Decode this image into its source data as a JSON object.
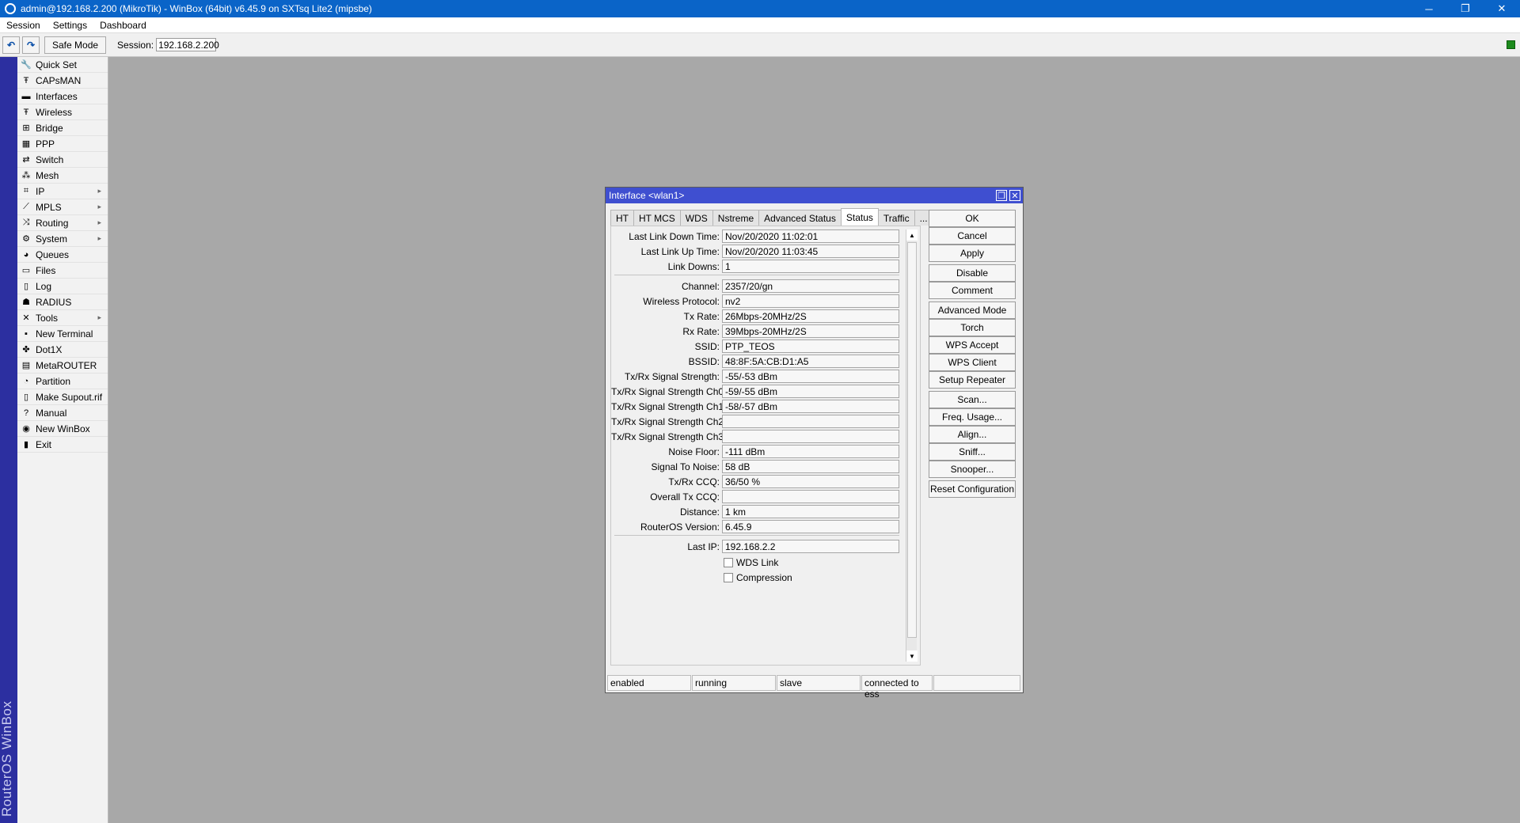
{
  "titlebar": {
    "title": "admin@192.168.2.200 (MikroTik) - WinBox (64bit) v6.45.9 on SXTsq Lite2 (mipsbe)",
    "minimize": "─",
    "restore": "❐",
    "close": "✕"
  },
  "menubar": {
    "items": [
      "Session",
      "Settings",
      "Dashboard"
    ]
  },
  "toolbar": {
    "undo": "↶",
    "redo": "↷",
    "safe_mode": "Safe Mode",
    "session_label": "Session:",
    "session_value": "192.168.2.200"
  },
  "side_strip": {
    "text": "RouterOS WinBox"
  },
  "sidebar": {
    "items": [
      {
        "label": "Quick Set",
        "icon": "🔧"
      },
      {
        "label": "CAPsMAN",
        "icon": "Ŧ"
      },
      {
        "label": "Interfaces",
        "icon": "▬"
      },
      {
        "label": "Wireless",
        "icon": "Ŧ"
      },
      {
        "label": "Bridge",
        "icon": "⊞"
      },
      {
        "label": "PPP",
        "icon": "▦"
      },
      {
        "label": "Switch",
        "icon": "⇄"
      },
      {
        "label": "Mesh",
        "icon": "⁂"
      },
      {
        "label": "IP",
        "icon": "⌗",
        "submenu": "▸"
      },
      {
        "label": "MPLS",
        "icon": "⟋",
        "submenu": "▸"
      },
      {
        "label": "Routing",
        "icon": "⤨",
        "submenu": "▸"
      },
      {
        "label": "System",
        "icon": "⚙",
        "submenu": "▸"
      },
      {
        "label": "Queues",
        "icon": "◕"
      },
      {
        "label": "Files",
        "icon": "▭"
      },
      {
        "label": "Log",
        "icon": "▯"
      },
      {
        "label": "RADIUS",
        "icon": "☗"
      },
      {
        "label": "Tools",
        "icon": "✕",
        "submenu": "▸"
      },
      {
        "label": "New Terminal",
        "icon": "▪"
      },
      {
        "label": "Dot1X",
        "icon": "✤"
      },
      {
        "label": "MetaROUTER",
        "icon": "▤"
      },
      {
        "label": "Partition",
        "icon": "◔"
      },
      {
        "label": "Make Supout.rif",
        "icon": "▯"
      },
      {
        "label": "Manual",
        "icon": "?"
      },
      {
        "label": "New WinBox",
        "icon": "◉"
      },
      {
        "label": "Exit",
        "icon": "▮"
      }
    ]
  },
  "window": {
    "title": "Interface <wlan1>",
    "restore_icon": "❐",
    "close_icon": "✕",
    "tabs": [
      {
        "label": "HT",
        "active": false
      },
      {
        "label": "HT MCS",
        "active": false
      },
      {
        "label": "WDS",
        "active": false
      },
      {
        "label": "Nstreme",
        "active": false
      },
      {
        "label": "Advanced Status",
        "active": false
      },
      {
        "label": "Status",
        "active": true
      },
      {
        "label": "Traffic",
        "active": false
      },
      {
        "label": "...",
        "active": false
      }
    ],
    "fields": [
      {
        "label": "Last Link Down Time:",
        "value": "Nov/20/2020 11:02:01"
      },
      {
        "label": "Last Link Up Time:",
        "value": "Nov/20/2020 11:03:45"
      },
      {
        "label": "Link Downs:",
        "value": "1"
      },
      {
        "label": "Channel:",
        "value": "2357/20/gn"
      },
      {
        "label": "Wireless Protocol:",
        "value": "nv2"
      },
      {
        "label": "Tx Rate:",
        "value": "26Mbps-20MHz/2S"
      },
      {
        "label": "Rx Rate:",
        "value": "39Mbps-20MHz/2S"
      },
      {
        "label": "SSID:",
        "value": "PTP_TEOS"
      },
      {
        "label": "BSSID:",
        "value": "48:8F:5A:CB:D1:A5"
      },
      {
        "label": "Tx/Rx Signal Strength:",
        "value": "-55/-53 dBm"
      },
      {
        "label": "Tx/Rx Signal Strength Ch0:",
        "value": "-59/-55 dBm"
      },
      {
        "label": "Tx/Rx Signal Strength Ch1:",
        "value": "-58/-57 dBm"
      },
      {
        "label": "Tx/Rx Signal Strength Ch2:",
        "value": ""
      },
      {
        "label": "Tx/Rx Signal Strength Ch3:",
        "value": ""
      },
      {
        "label": "Noise Floor:",
        "value": "-111 dBm"
      },
      {
        "label": "Signal To Noise:",
        "value": "58 dB"
      },
      {
        "label": "Tx/Rx CCQ:",
        "value": "36/50 %"
      },
      {
        "label": "Overall Tx CCQ:",
        "value": ""
      },
      {
        "label": "Distance:",
        "value": "1 km"
      },
      {
        "label": "RouterOS Version:",
        "value": "6.45.9"
      },
      {
        "label": "Last IP:",
        "value": "192.168.2.2"
      }
    ],
    "checkboxes": [
      {
        "label": "WDS Link",
        "checked": false
      },
      {
        "label": "Compression",
        "checked": false
      }
    ],
    "scroll_up": "▲",
    "scroll_down": "▼",
    "buttons": [
      "OK",
      "Cancel",
      "Apply",
      "Disable",
      "Comment",
      "Advanced Mode",
      "Torch",
      "WPS Accept",
      "WPS Client",
      "Setup Repeater",
      "Scan...",
      "Freq. Usage...",
      "Align...",
      "Sniff...",
      "Snooper...",
      "Reset Configuration"
    ],
    "status": [
      "enabled",
      "running",
      "slave",
      "connected to ess",
      ""
    ]
  },
  "colors": {
    "titlebar": "#0a64c8",
    "window_title": "#3f4fd0",
    "side_strip": "#2c2fa0",
    "desktop": "#a8a8a8",
    "connection_indicator": "#1c8a1c"
  }
}
